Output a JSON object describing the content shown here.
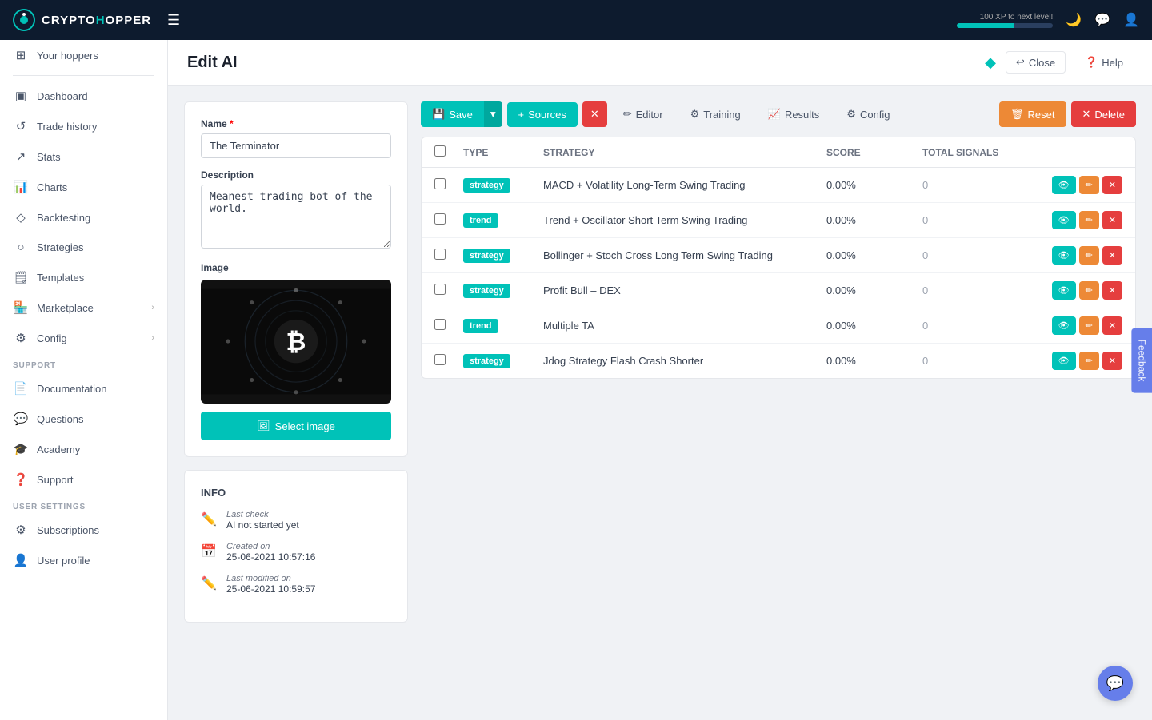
{
  "topnav": {
    "logo": "CRYPTOHOPPER",
    "logo_highlight": "O",
    "xp_label": "100 XP to next level!",
    "xp_percent": 60
  },
  "sidebar": {
    "items": [
      {
        "id": "your-hoppers",
        "label": "Your hoppers",
        "icon": "⊞"
      },
      {
        "id": "dashboard",
        "label": "Dashboard",
        "icon": "⊡"
      },
      {
        "id": "trade-history",
        "label": "Trade history",
        "icon": "↺"
      },
      {
        "id": "stats",
        "label": "Stats",
        "icon": "↗"
      },
      {
        "id": "charts",
        "label": "Charts",
        "icon": "📊"
      },
      {
        "id": "backtesting",
        "label": "Backtesting",
        "icon": "◇"
      },
      {
        "id": "strategies",
        "label": "Strategies",
        "icon": "○"
      },
      {
        "id": "templates",
        "label": "Templates",
        "icon": "🗒"
      },
      {
        "id": "marketplace",
        "label": "Marketplace",
        "icon": "🏪",
        "arrow": "›"
      },
      {
        "id": "config",
        "label": "Config",
        "icon": "⚙",
        "arrow": "›"
      }
    ],
    "support_section": "SUPPORT",
    "support_items": [
      {
        "id": "documentation",
        "label": "Documentation",
        "icon": "📄"
      },
      {
        "id": "questions",
        "label": "Questions",
        "icon": "💬"
      },
      {
        "id": "academy",
        "label": "Academy",
        "icon": "🎓"
      },
      {
        "id": "support",
        "label": "Support",
        "icon": "❓"
      }
    ],
    "user_section": "USER SETTINGS",
    "user_items": [
      {
        "id": "subscriptions",
        "label": "Subscriptions",
        "icon": "⚙"
      },
      {
        "id": "user-profile",
        "label": "User profile",
        "icon": "👤"
      }
    ]
  },
  "page": {
    "title": "Edit AI",
    "close_label": "Close",
    "help_label": "Help"
  },
  "form": {
    "name_label": "Name",
    "name_required": true,
    "name_value": "The Terminator",
    "description_label": "Description",
    "description_value": "Meanest trading bot of the world.",
    "image_label": "Image",
    "select_image_label": "Select image"
  },
  "info": {
    "section_label": "INFO",
    "last_check_label": "Last check",
    "last_check_value": "AI not started yet",
    "created_on_label": "Created on",
    "created_on_value": "25-06-2021 10:57:16",
    "last_modified_label": "Last modified on",
    "last_modified_value": "25-06-2021 10:59:57"
  },
  "toolbar": {
    "save_label": "Save",
    "sources_label": "Sources",
    "editor_label": "Editor",
    "training_label": "Training",
    "results_label": "Results",
    "config_label": "Config",
    "reset_label": "Reset",
    "delete_label": "Delete"
  },
  "table": {
    "columns": [
      "",
      "Type",
      "Strategy",
      "Score",
      "Total signals",
      ""
    ],
    "rows": [
      {
        "type": "strategy",
        "type_badge": "strategy",
        "strategy": "MACD + Volatility Long-Term Swing Trading",
        "score": "0.00%",
        "total_signals": "0"
      },
      {
        "type": "trend",
        "type_badge": "trend",
        "strategy": "Trend + Oscillator Short Term Swing Trading",
        "score": "0.00%",
        "total_signals": "0"
      },
      {
        "type": "strategy",
        "type_badge": "strategy",
        "strategy": "Bollinger + Stoch Cross Long Term Swing Trading",
        "score": "0.00%",
        "total_signals": "0"
      },
      {
        "type": "strategy",
        "type_badge": "strategy",
        "strategy": "Profit Bull – DEX",
        "score": "0.00%",
        "total_signals": "0"
      },
      {
        "type": "trend",
        "type_badge": "trend",
        "strategy": "Multiple TA",
        "score": "0.00%",
        "total_signals": "0"
      },
      {
        "type": "strategy",
        "type_badge": "strategy",
        "strategy": "Jdog Strategy Flash Crash Shorter",
        "score": "0.00%",
        "total_signals": "0"
      }
    ]
  },
  "feedback": {
    "label": "Feedback"
  },
  "chat": {
    "icon": "💬"
  }
}
